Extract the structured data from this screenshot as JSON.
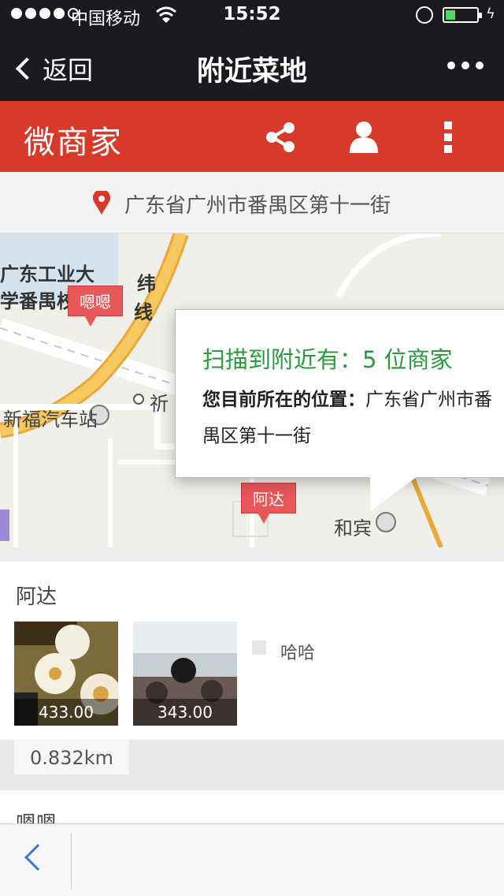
{
  "status_bar": {
    "carrier": "中国移动",
    "time": "15:52",
    "battery_level": 0.3
  },
  "nav": {
    "back_label": "返回",
    "title": "附近菜地"
  },
  "brand": {
    "name": "微商家",
    "color": "#d7392b"
  },
  "location": {
    "address": "广东省广州市番禺区第十一街"
  },
  "map": {
    "labels": {
      "campus_line1": "广东工业大",
      "campus_line2": "学番禺校",
      "road_vertical": "纬",
      "road_vertical2": "线",
      "station": "新福汽车站",
      "qi": "祈",
      "hebin": "和宾"
    },
    "markers": {
      "m1": "嗯嗯",
      "m2": "阿达"
    },
    "popup": {
      "scan_text": "扫描到附近有：5 位商家",
      "position_label": "您目前所在的位置：",
      "position_value_line1": "广东省广州市番",
      "position_value_line2": "禺区第十一街"
    }
  },
  "store": {
    "name": "阿达",
    "items": [
      {
        "price": "433.00"
      },
      {
        "price": "343.00"
      }
    ],
    "tag": "哈哈",
    "distance": "0.832km"
  },
  "next_store": {
    "name": "嗯嗯"
  }
}
